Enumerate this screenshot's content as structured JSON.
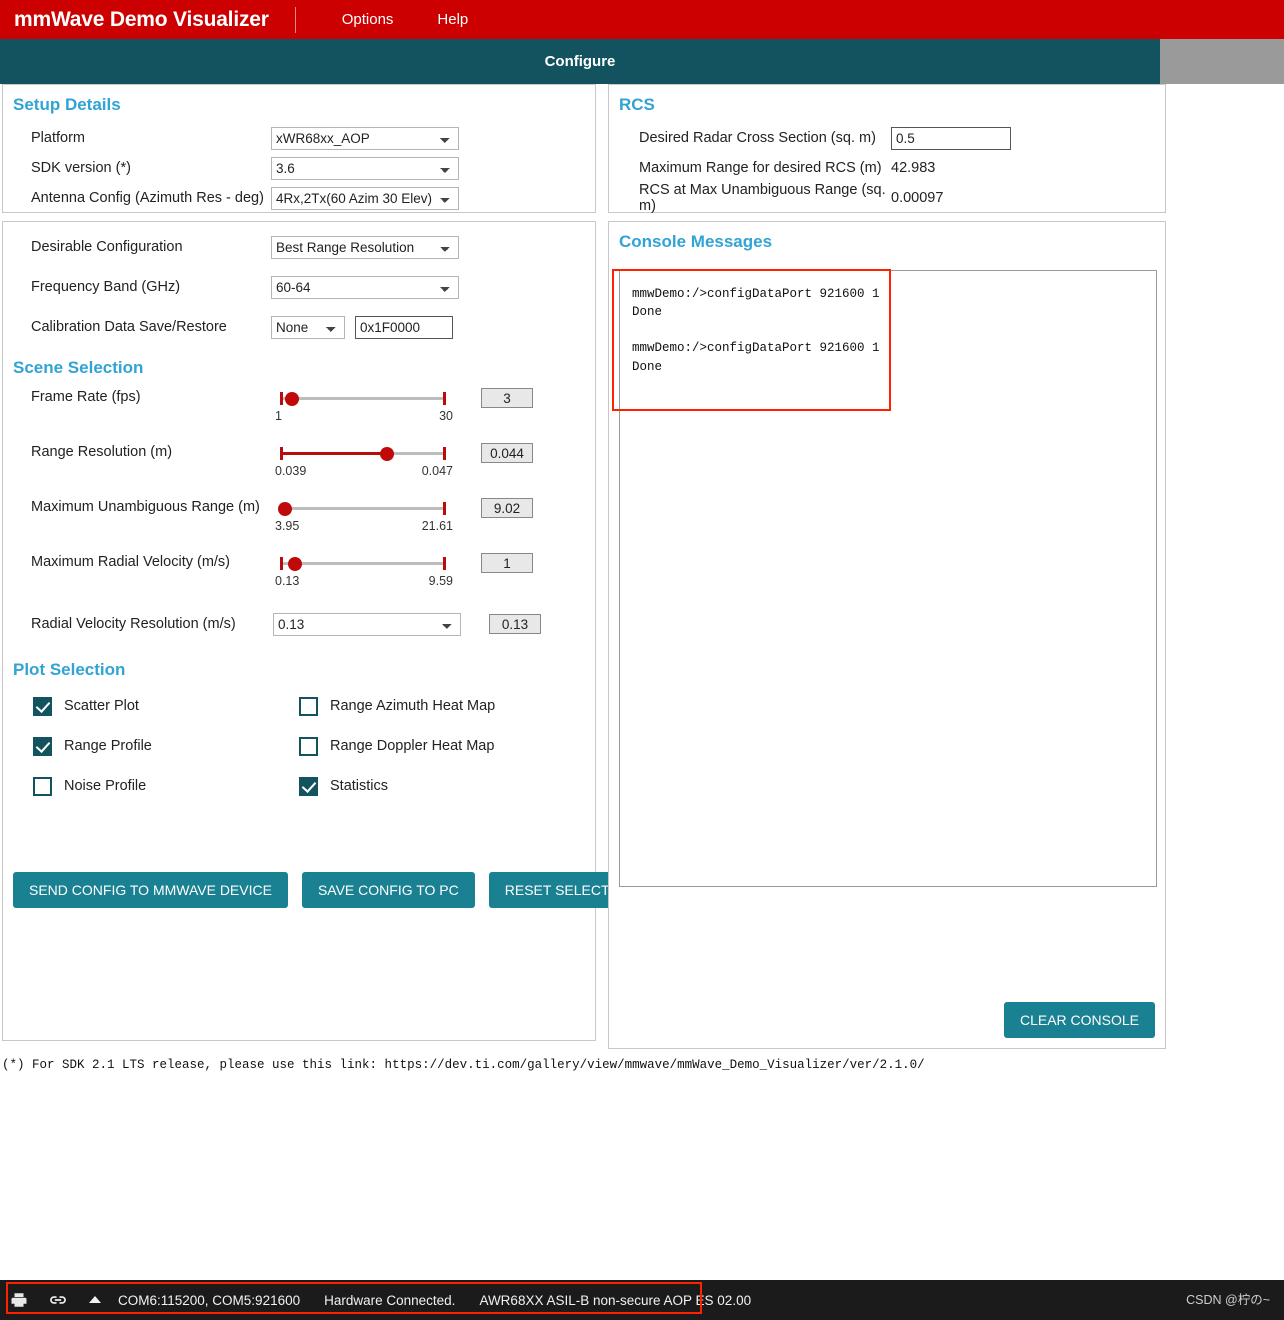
{
  "header": {
    "brand": "mmWave Demo Visualizer",
    "menu": [
      "Options",
      "Help"
    ],
    "active_tab": "Configure",
    "brand_bg": "#cc0000",
    "tab_bg": "#13535f"
  },
  "setup_details": {
    "title": "Setup Details",
    "rows": [
      {
        "label": "Platform",
        "value": "xWR68xx_AOP"
      },
      {
        "label": "SDK version (*)",
        "value": "3.6"
      },
      {
        "label": "Antenna Config (Azimuth Res - deg)",
        "value": "4Rx,2Tx(60 Azim 30 Elev)"
      }
    ]
  },
  "rcs": {
    "title": "RCS",
    "desired_label": "Desired Radar Cross Section (sq. m)",
    "desired_value": "0.5",
    "max_range_label": "Maximum Range for desired RCS (m)",
    "max_range_value": "42.983",
    "rcs_max_label": "RCS at Max Unambiguous Range (sq. m)",
    "rcs_max_value": "0.00097"
  },
  "configuration": {
    "rows": [
      {
        "label": "Desirable Configuration",
        "value": "Best Range Resolution"
      },
      {
        "label": "Frequency Band (GHz)",
        "value": "60-64"
      }
    ],
    "calibration": {
      "label": "Calibration Data Save/Restore",
      "mode": "None",
      "address": "0x1F0000"
    }
  },
  "scene_selection": {
    "title": "Scene Selection",
    "sliders": [
      {
        "label": "Frame Rate (fps)",
        "min": "1",
        "max": "30",
        "value": "3",
        "pct": 7,
        "filled": false
      },
      {
        "label": "Range Resolution (m)",
        "min": "0.039",
        "max": "0.047",
        "value": "0.044",
        "pct": 62,
        "filled": true
      },
      {
        "label": "Maximum Unambiguous Range (m)",
        "min": "3.95",
        "max": "21.61",
        "value": "9.02",
        "pct": 3,
        "filled": false
      },
      {
        "label": "Maximum Radial Velocity (m/s)",
        "min": "0.13",
        "max": "9.59",
        "value": "1",
        "pct": 9,
        "filled": false
      }
    ],
    "radial_velocity_resolution": {
      "label": "Radial Velocity Resolution (m/s)",
      "value": "0.13",
      "display": "0.13"
    }
  },
  "plot_selection": {
    "title": "Plot Selection",
    "left": [
      {
        "label": "Scatter Plot",
        "checked": true
      },
      {
        "label": "Range Profile",
        "checked": true
      },
      {
        "label": "Noise Profile",
        "checked": false
      }
    ],
    "right": [
      {
        "label": "Range Azimuth Heat Map",
        "checked": false
      },
      {
        "label": "Range Doppler Heat Map",
        "checked": false
      },
      {
        "label": "Statistics",
        "checked": true
      }
    ]
  },
  "actions": {
    "send_config": "SEND CONFIG TO MMWAVE DEVICE",
    "save_config": "SAVE CONFIG TO PC",
    "reset_selection": "RESET SELECTION"
  },
  "console": {
    "title": "Console Messages",
    "text": "mmwDemo:/>configDataPort 921600 1\nDone\n\nmmwDemo:/>configDataPort 921600 1\nDone",
    "clear_label": "CLEAR CONSOLE"
  },
  "footnote": "(*) For SDK 2.1 LTS release, please use this link: https://dev.ti.com/gallery/view/mmwave/mmWave_Demo_Visualizer/ver/2.1.0/",
  "taskbar": {
    "ports": "COM6:115200, COM5:921600",
    "status": "Hardware Connected.",
    "device": "AWR68XX ASIL-B non-secure AOP ES 02.00",
    "watermark": "CSDN @柠の~"
  },
  "annotation_color": "#ff2200"
}
